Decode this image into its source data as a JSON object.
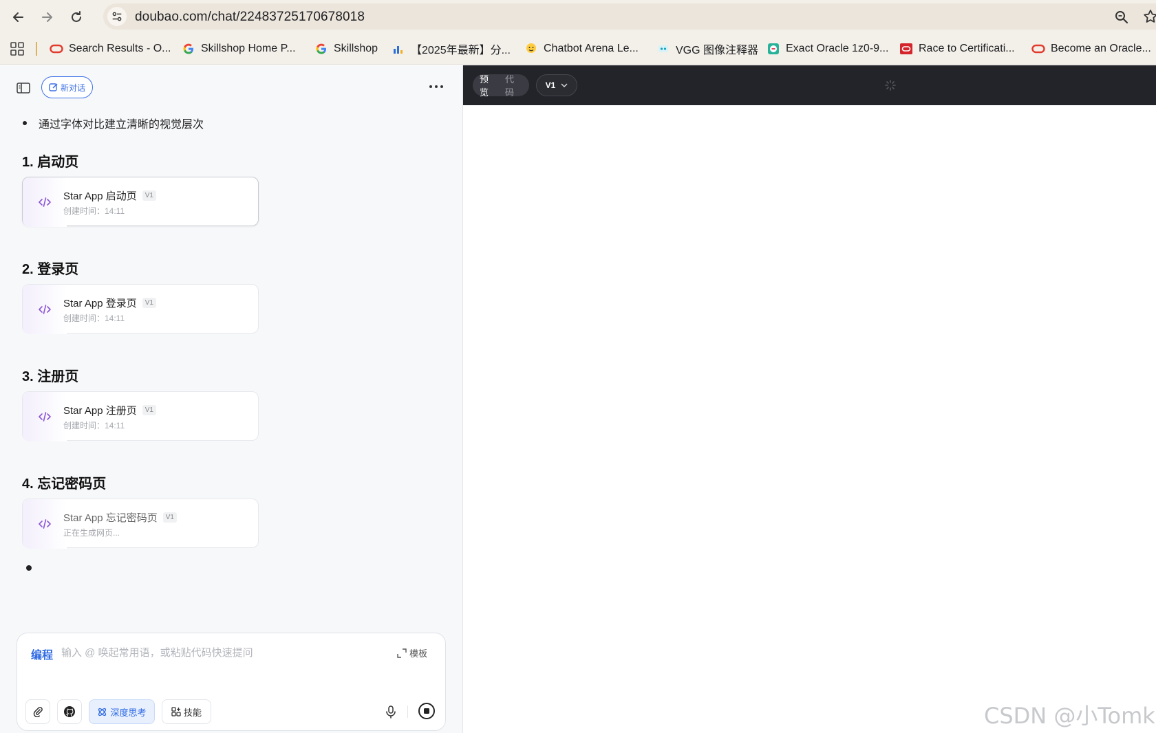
{
  "browser": {
    "url": "doubao.com/chat/22483725170678018",
    "bookmarks": [
      {
        "label": "Search Results - O...",
        "icon": "oracle-icon"
      },
      {
        "label": "Skillshop Home P...",
        "icon": "google-icon"
      },
      {
        "label": "Skillshop",
        "icon": "google-icon"
      },
      {
        "label": "【2025年最新】分...",
        "icon": "chart-icon"
      },
      {
        "label": "Chatbot Arena Le...",
        "icon": "hugging-face-icon"
      },
      {
        "label": "VGG 图像注释器",
        "icon": "vgg-icon"
      },
      {
        "label": "Exact Oracle 1z0-9...",
        "icon": "exam-icon"
      },
      {
        "label": "Race to Certificati...",
        "icon": "oracle-square-icon"
      },
      {
        "label": "Become an Oracle...",
        "icon": "oracle-icon"
      }
    ]
  },
  "chat": {
    "new_chat_label": "新对话",
    "bullet_text": "通过字体对比建立清晰的视觉层次",
    "sections": [
      {
        "heading": "1. 启动页",
        "card_title": "Star App 启动页",
        "version": "V1",
        "sub": "创建时间：14:11"
      },
      {
        "heading": "2. 登录页",
        "card_title": "Star App 登录页",
        "version": "V1",
        "sub": "创建时间：14:11"
      },
      {
        "heading": "3. 注册页",
        "card_title": "Star App 注册页",
        "version": "V1",
        "sub": "创建时间：14:11"
      },
      {
        "heading": "4. 忘记密码页",
        "card_title": "Star App 忘记密码页",
        "version": "V1",
        "sub": "正在生成网页..."
      }
    ]
  },
  "composer": {
    "mode": "编程",
    "placeholder": "输入 @ 唤起常用语，或粘贴代码快速提问",
    "template_label": "模板",
    "deep_think_label": "深度思考",
    "skills_label": "技能"
  },
  "preview": {
    "tab_preview": "预览",
    "tab_code": "代码",
    "version": "V1"
  },
  "watermark": "CSDN @小Tomkk",
  "colors": {
    "accent": "#2f6ae4",
    "preview_bar": "#23242a",
    "left_bg": "#f7f8fa"
  }
}
